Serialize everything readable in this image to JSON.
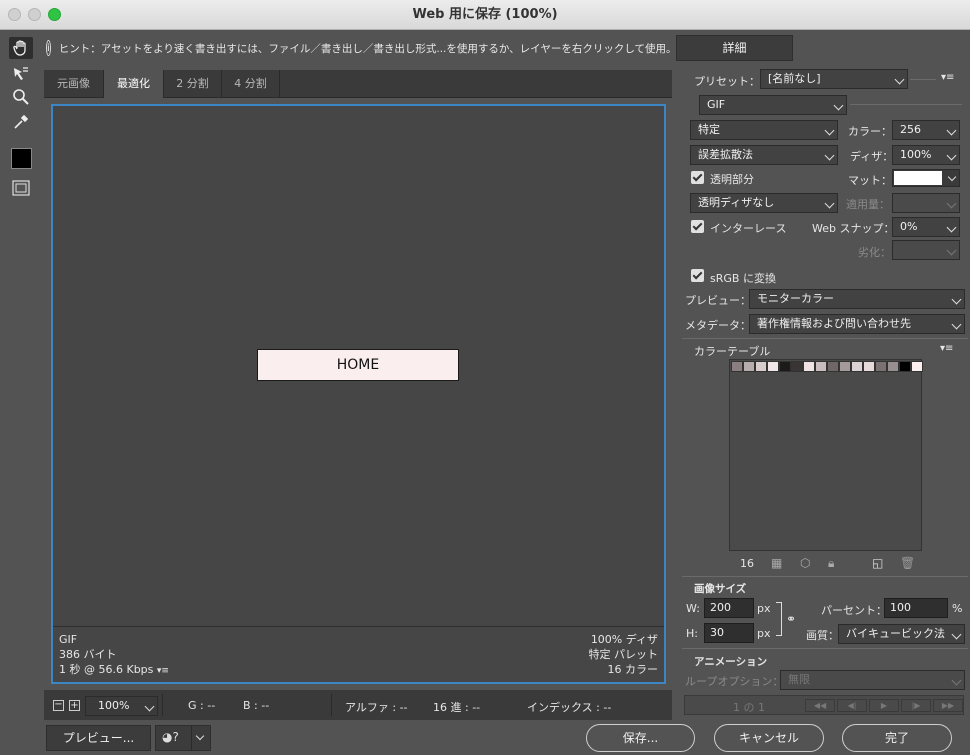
{
  "window": {
    "title": "Web 用に保存 (100%)"
  },
  "hint": {
    "text": "ヒント：アセットをより速く書き出すには、ファイル／書き出し／書き出し形式...を使用するか、レイヤーを右クリックして使用。"
  },
  "detail_button": "詳細",
  "tabs": [
    {
      "label": "元画像",
      "active": false
    },
    {
      "label": "最適化",
      "active": true
    },
    {
      "label": "2 分割",
      "active": false
    },
    {
      "label": "4 分割",
      "active": false
    }
  ],
  "canvas": {
    "home_label": "HOME",
    "home_fill": "#fbeeee",
    "frame_color": "#3d86c6",
    "info_left": [
      "GIF",
      "386 バイト",
      "1 秒 @ 56.6 Kbps"
    ],
    "info_right": [
      "100% ディザ",
      "特定 パレット",
      "16 カラー"
    ]
  },
  "bottombar": {
    "zoom": "100%",
    "g": "G : --",
    "b": "B : --",
    "alpha": "アルファ : --",
    "hex": "16 進 : --",
    "index": "インデックス : --"
  },
  "buttons": {
    "preview": "プレビュー...",
    "save": "保存...",
    "cancel": "キャンセル",
    "done": "完了"
  },
  "settings": {
    "preset_label": "プリセット：",
    "preset_value": "[名前なし]",
    "format": "GIF",
    "reduction": "特定",
    "color_label": "カラー：",
    "color_value": "256",
    "dither_algo": "誤差拡散法",
    "dither_label": "ディザ：",
    "dither_value": "100%",
    "transparency_label": "透明部分",
    "transparency_checked": true,
    "matte_label": "マット：",
    "matte_color": "#ffffff",
    "trans_dither": "透明ディザなし",
    "amount_label": "適用量：",
    "interlace_label": "インターレース",
    "interlace_checked": true,
    "websnap_label": "Web スナップ：",
    "websnap_value": "0%",
    "lossy_label": "劣化：",
    "srgb_label": "sRGB に変換",
    "srgb_checked": true,
    "preview_label": "プレビュー：",
    "preview_value": "モニターカラー",
    "metadata_label": "メタデータ：",
    "metadata_value": "著作権情報および問い合わせ先"
  },
  "color_table": {
    "title": "カラーテーブル",
    "count": "16",
    "swatches": [
      "#8a7e80",
      "#b8acae",
      "#d8cccd",
      "#f0e6e7",
      "#1c1a1a",
      "#3a3535",
      "#efe3e4",
      "#c8bcbe",
      "#6e6667",
      "#a59a9b",
      "#ddd2d3",
      "#e6dadb",
      "#7a7172",
      "#9a8f90",
      "#000000",
      "#fbeeee"
    ]
  },
  "image_size": {
    "title": "画像サイズ",
    "w_label": "W:",
    "w_value": "200",
    "h_label": "H:",
    "h_value": "30",
    "unit": "px",
    "percent_label": "パーセント：",
    "percent_value": "100",
    "percent_unit": "%",
    "quality_label": "画質：",
    "quality_value": "バイキュービック法"
  },
  "animation": {
    "title": "アニメーション",
    "loop_label": "ループオプション：",
    "loop_value": "無限",
    "frame_counter": "1 の 1"
  }
}
